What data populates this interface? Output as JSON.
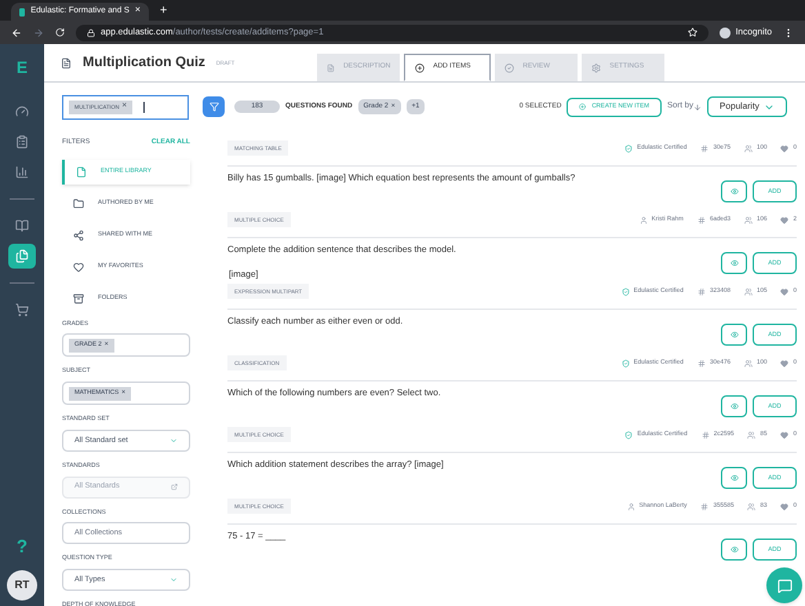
{
  "browser": {
    "tab_title": "Edulastic: Formative and S",
    "tab_close": "×",
    "new_tab": "+",
    "url_host": "app.edulastic.com",
    "url_path": "/author/tests/create/additems?page=1",
    "profile": "Incognito"
  },
  "nav": {
    "logo": "E",
    "groups": [
      [
        {
          "kind": "gauge",
          "selected": false
        },
        {
          "kind": "clipboard",
          "selected": false
        },
        {
          "kind": "chart",
          "selected": false
        }
      ],
      [
        {
          "kind": "book",
          "selected": false
        },
        {
          "kind": "files",
          "selected": true
        }
      ],
      [
        {
          "kind": "cart",
          "selected": false
        }
      ]
    ],
    "help": "?",
    "avatar": "RT"
  },
  "header": {
    "title": "Multiplication Quiz",
    "badge": "DRAFT",
    "tabs": [
      {
        "label": "DESCRIPTION",
        "kind": "description",
        "selected": false
      },
      {
        "label": "ADD ITEMS",
        "kind": "add",
        "selected": true
      },
      {
        "label": "REVIEW",
        "kind": "review",
        "selected": false
      },
      {
        "label": "SETTINGS",
        "kind": "settings",
        "selected": false
      }
    ]
  },
  "toolbar": {
    "search_tag": "MULTIPLICATION",
    "tag_remove": "×",
    "question_count": "183",
    "count_label": "QUESTIONS FOUND",
    "chips": [
      {
        "label": "Grade 2",
        "remove": "×"
      },
      {
        "label": "+1"
      }
    ],
    "selected_count": "0 SELECTED",
    "create_button": "CREATE NEW ITEM",
    "sort_label": "Sort by",
    "sort_value": "Popularity"
  },
  "filters": {
    "heading": "FILTERS",
    "clear": "CLEAR ALL",
    "sources": [
      {
        "label": "ENTIRE LIBRARY",
        "kind": "library",
        "selected": true
      },
      {
        "label": "AUTHORED BY ME",
        "kind": "folder",
        "selected": false
      },
      {
        "label": "SHARED WITH ME",
        "kind": "share",
        "selected": false
      },
      {
        "label": "MY FAVORITES",
        "kind": "heart",
        "selected": false
      },
      {
        "label": "FOLDERS",
        "kind": "folders",
        "selected": false
      }
    ],
    "fields": [
      {
        "label": "GRADES",
        "kind": "tags",
        "tags": [
          {
            "label": "GRADE 2",
            "remove": "×"
          }
        ]
      },
      {
        "label": "SUBJECT",
        "kind": "tags",
        "tags": [
          {
            "label": "MATHEMATICS",
            "remove": "×"
          }
        ]
      },
      {
        "label": "STANDARD SET",
        "kind": "select",
        "value": "All Standard set"
      },
      {
        "label": "STANDARDS",
        "kind": "input",
        "placeholder": "All Standards",
        "disabled": true
      },
      {
        "label": "COLLECTIONS",
        "kind": "input",
        "placeholder": "All Collections",
        "disabled": false
      },
      {
        "label": "QUESTION TYPE",
        "kind": "select",
        "value": "All Types"
      },
      {
        "label": "DEPTH OF KNOWLEDGE",
        "kind": "label"
      }
    ]
  },
  "items": [
    {
      "type": "MATCHING TABLE",
      "certified": true,
      "author": "Edulastic Certified",
      "id": "30e75",
      "views": "100",
      "likes": "0",
      "question": "Billy has 15 gumballs.  [image] Which equation best represents the amount of gumballs?",
      "add_button": "ADD"
    },
    {
      "type": "MULTIPLE CHOICE",
      "certified": false,
      "author": "Kristi Rahm",
      "id": "6aded3",
      "views": "106",
      "likes": "2",
      "question": "Complete the addition sentence that describes the model.",
      "extra": "[image]",
      "add_button": "ADD"
    },
    {
      "type": "EXPRESSION MULTIPART",
      "certified": true,
      "author": "Edulastic Certified",
      "id": "323408",
      "views": "105",
      "likes": "0",
      "question": "Classify each number as either even or odd.",
      "add_button": "ADD"
    },
    {
      "type": "CLASSIFICATION",
      "certified": true,
      "author": "Edulastic Certified",
      "id": "30e476",
      "views": "100",
      "likes": "0",
      "question": "Which of the following numbers are even?  Select two.",
      "add_button": "ADD"
    },
    {
      "type": "MULTIPLE CHOICE",
      "certified": true,
      "author": "Edulastic Certified",
      "id": "2c2595",
      "views": "85",
      "likes": "0",
      "question": "Which addition statement describes the array?  [image]",
      "add_button": "ADD"
    },
    {
      "type": "MULTIPLE CHOICE",
      "certified": false,
      "author": "Shannon LaBerty",
      "id": "355585",
      "views": "83",
      "likes": "0",
      "question": "75 - 17 = ____",
      "add_button": "ADD"
    }
  ]
}
